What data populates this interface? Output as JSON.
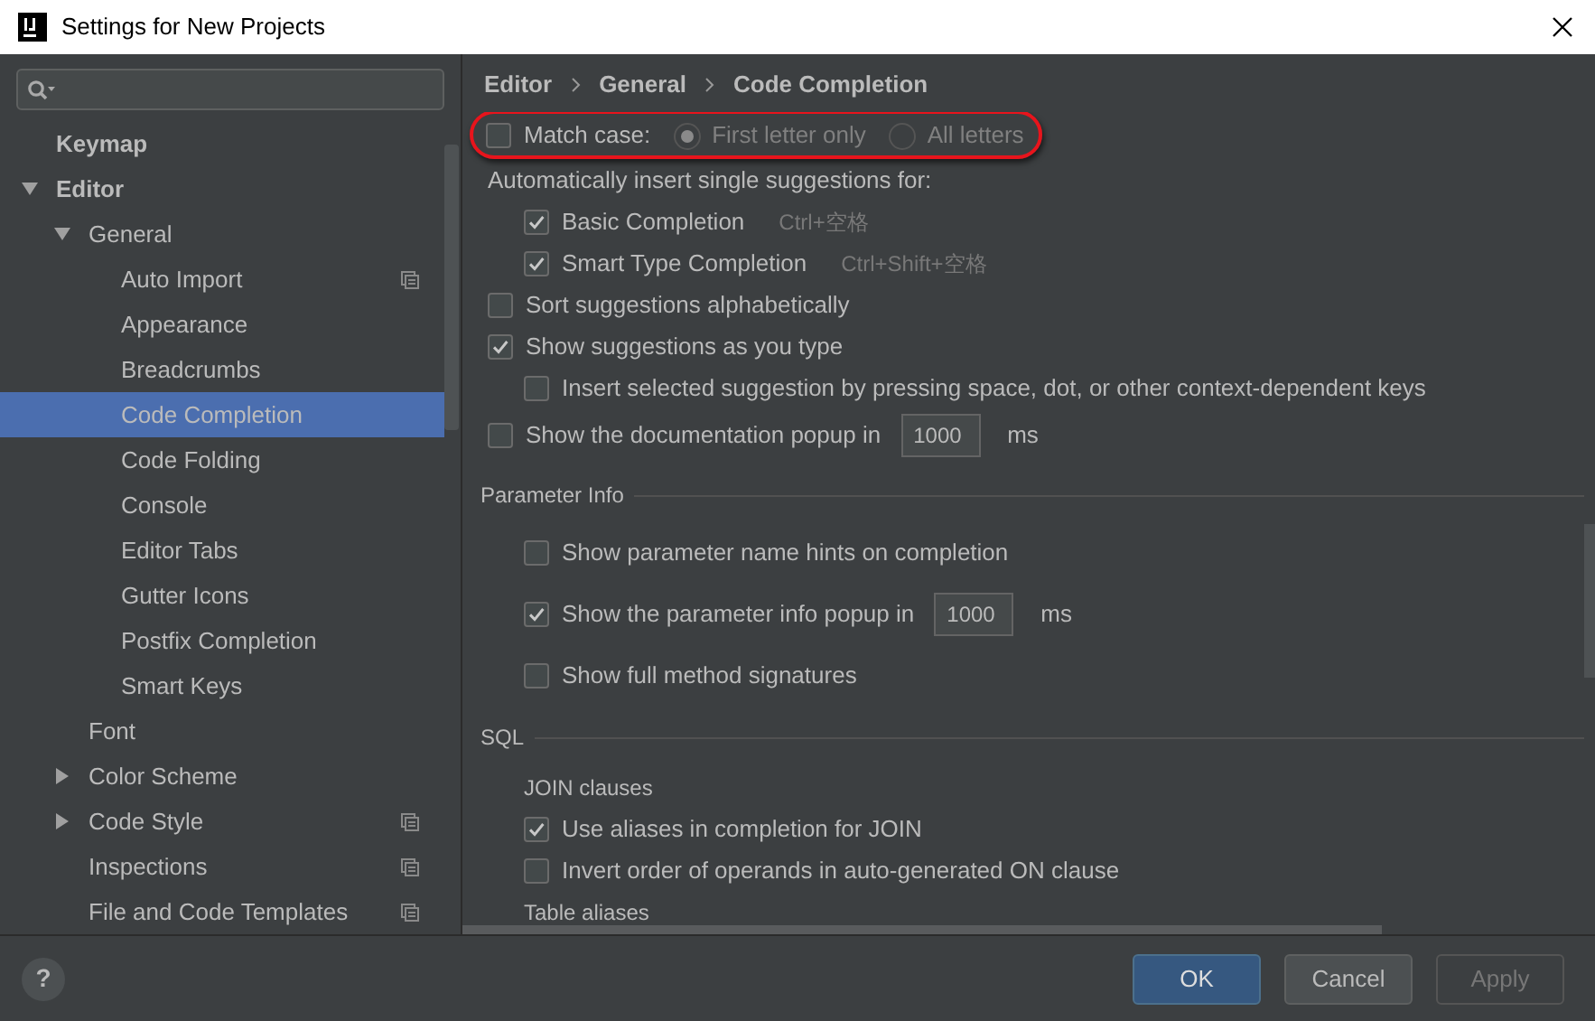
{
  "window": {
    "title": "Settings for New Projects"
  },
  "sidebar": {
    "tree": [
      {
        "label": "Keymap",
        "bold": true,
        "selected": false
      },
      {
        "label": "Editor",
        "bold": true,
        "expanded": true,
        "selected": false,
        "children": [
          {
            "label": "General",
            "expanded": true,
            "selected": false,
            "children": [
              {
                "label": "Auto Import",
                "selected": false,
                "project_scope": true
              },
              {
                "label": "Appearance",
                "selected": false
              },
              {
                "label": "Breadcrumbs",
                "selected": false
              },
              {
                "label": "Code Completion",
                "selected": true
              },
              {
                "label": "Code Folding",
                "selected": false
              },
              {
                "label": "Console",
                "selected": false
              },
              {
                "label": "Editor Tabs",
                "selected": false
              },
              {
                "label": "Gutter Icons",
                "selected": false
              },
              {
                "label": "Postfix Completion",
                "selected": false
              },
              {
                "label": "Smart Keys",
                "selected": false
              }
            ]
          },
          {
            "label": "Font",
            "selected": false
          },
          {
            "label": "Color Scheme",
            "expanded": false,
            "selected": false
          },
          {
            "label": "Code Style",
            "expanded": false,
            "selected": false,
            "project_scope": true
          },
          {
            "label": "Inspections",
            "selected": false,
            "project_scope": true
          },
          {
            "label": "File and Code Templates",
            "selected": false,
            "project_scope": true
          }
        ]
      }
    ]
  },
  "breadcrumb": [
    "Editor",
    "General",
    "Code Completion"
  ],
  "match_case": {
    "label": "Match case:",
    "checked": false,
    "highlighted": true,
    "options": [
      {
        "label": "First letter only",
        "selected": true,
        "disabled": true
      },
      {
        "label": "All letters",
        "selected": false,
        "disabled": true
      }
    ]
  },
  "sections": [
    {
      "rows": [
        {
          "kind": "label",
          "label": "Automatically insert single suggestions for:",
          "children": [
            {
              "kind": "checkbox",
              "label": "Basic Completion",
              "checked": true,
              "shortcut": "Ctrl+空格"
            },
            {
              "kind": "checkbox",
              "label": "Smart Type Completion",
              "checked": true,
              "shortcut": "Ctrl+Shift+空格"
            }
          ]
        },
        {
          "kind": "checkbox",
          "label": "Sort suggestions alphabetically",
          "checked": false
        },
        {
          "kind": "checkbox",
          "label": "Show suggestions as you type",
          "checked": true,
          "children": [
            {
              "kind": "checkbox",
              "label": "Insert selected suggestion by pressing space, dot, or other context-dependent keys",
              "checked": false
            }
          ]
        },
        {
          "kind": "checkbox_field",
          "label": "Show the documentation popup in",
          "checked": false,
          "value": "1000",
          "unit": "ms"
        }
      ]
    },
    {
      "title": "Parameter Info",
      "rows": [
        {
          "kind": "checkbox",
          "label": "Show parameter name hints on completion",
          "checked": false
        },
        {
          "kind": "checkbox_field",
          "label": "Show the parameter info popup in",
          "checked": true,
          "value": "1000",
          "unit": "ms"
        },
        {
          "kind": "checkbox",
          "label": "Show full method signatures",
          "checked": false
        }
      ]
    },
    {
      "title": "SQL",
      "rows": [
        {
          "kind": "subheading",
          "label": "JOIN clauses"
        },
        {
          "kind": "checkbox",
          "label": "Use aliases in completion for JOIN",
          "checked": true
        },
        {
          "kind": "checkbox",
          "label": "Invert order of operands in auto-generated ON clause",
          "checked": false
        },
        {
          "kind": "subheading",
          "label": "Table aliases"
        }
      ]
    }
  ],
  "help_button": {
    "label": "?"
  },
  "buttons": [
    {
      "label": "OK",
      "kind": "primary",
      "disabled": false
    },
    {
      "label": "Cancel",
      "kind": "normal",
      "disabled": false
    },
    {
      "label": "Apply",
      "kind": "normal",
      "disabled": true
    }
  ]
}
